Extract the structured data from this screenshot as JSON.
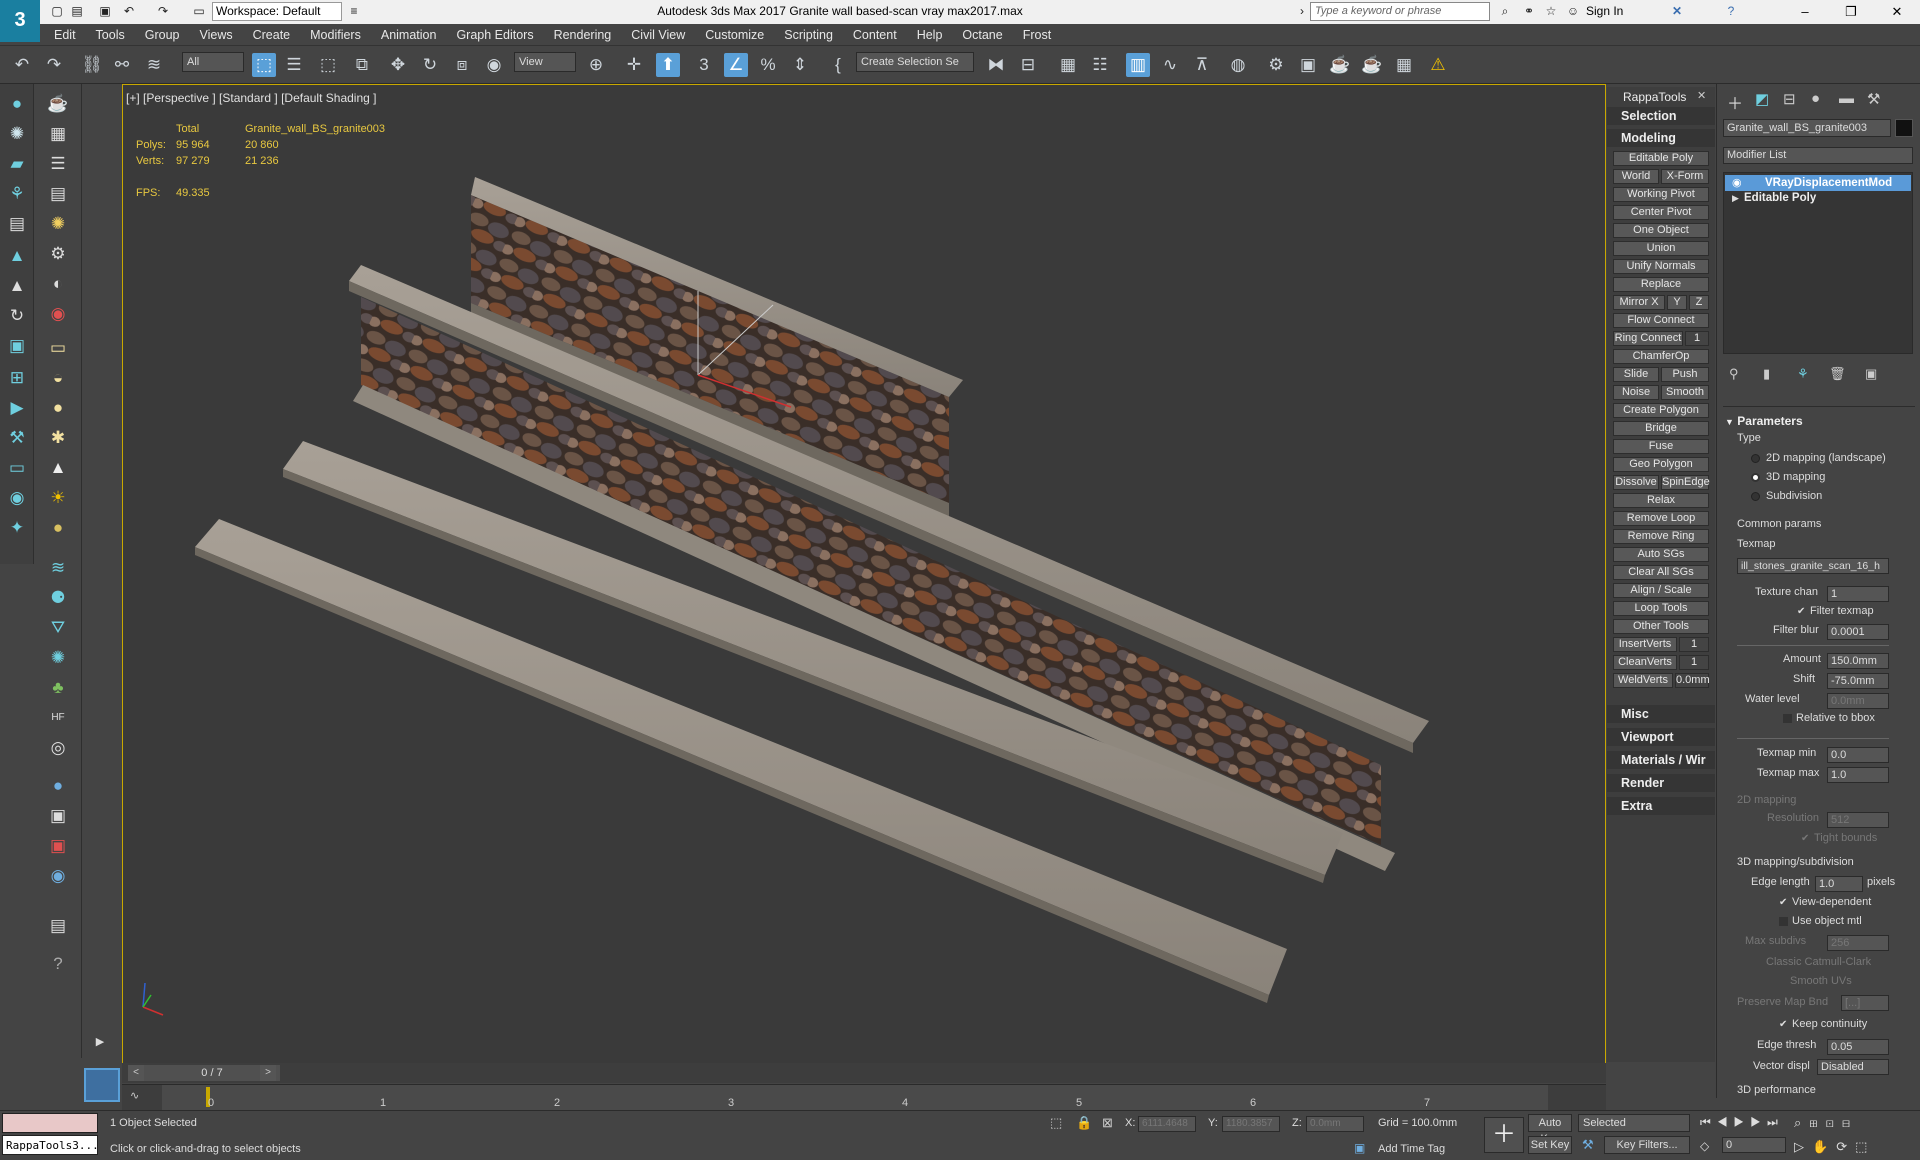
{
  "app": {
    "logo": "3",
    "workspace": "Workspace: Default",
    "title": "Autodesk 3ds Max 2017    Granite wall based-scan vray max2017.max",
    "search_placeholder": "Type a keyword or phrase",
    "sign_in": "Sign In"
  },
  "menu": [
    "Edit",
    "Tools",
    "Group",
    "Views",
    "Create",
    "Modifiers",
    "Animation",
    "Graph Editors",
    "Rendering",
    "Civil View",
    "Customize",
    "Scripting",
    "Content",
    "Help",
    "Octane",
    "Frost"
  ],
  "toolbar": {
    "filter": "All",
    "ref_coord": "View",
    "selection_set": "Create Selection Se"
  },
  "viewport": {
    "label": "[+] [Perspective ] [Standard ] [Default Shading ]",
    "stats": {
      "total_header": "Total",
      "object_header": "Granite_wall_BS_granite003",
      "polys_label": "Polys:",
      "polys_total": "95 964",
      "polys_object": "20 860",
      "verts_label": "Verts:",
      "verts_total": "97 279",
      "verts_object": "21 236",
      "fps_label": "FPS:",
      "fps": "49.335"
    }
  },
  "rappa": {
    "title": "RappaTools",
    "sections": {
      "selection": "Selection",
      "modeling": "Modeling",
      "misc": "Misc",
      "viewport": "Viewport",
      "materials": "Materials / Wir",
      "render": "Render",
      "extra": "Extra"
    },
    "buttons": {
      "editable_poly": "Editable Poly",
      "world": "World",
      "xform": "X-Form",
      "working_pivot": "Working Pivot",
      "center_pivot": "Center Pivot",
      "one_object": "One Object",
      "union": "Union",
      "unify_normals": "Unify Normals",
      "replace": "Replace",
      "mirror_x": "Mirror X",
      "y": "Y",
      "z": "Z",
      "flow_connect": "Flow Connect",
      "ring_connect": "Ring Connect",
      "ring_val": "1",
      "chamferop": "ChamferOp",
      "slide": "Slide",
      "push": "Push",
      "noise": "Noise",
      "smooth": "Smooth",
      "create_polygon": "Create Polygon",
      "bridge": "Bridge",
      "fuse": "Fuse",
      "geo_polygon": "Geo Polygon",
      "dissolve": "Dissolve",
      "spinedge": "SpinEdge",
      "relax": "Relax",
      "remove_loop": "Remove Loop",
      "remove_ring": "Remove Ring",
      "auto_sgs": "Auto SGs",
      "clear_all_sgs": "Clear All SGs",
      "align_scale": "Align / Scale",
      "loop_tools": "Loop Tools",
      "other_tools": "Other Tools",
      "insertverts": "InsertVerts",
      "insertverts_val": "1",
      "cleanverts": "CleanVerts",
      "cleanverts_val": "1",
      "weldverts": "WeldVerts",
      "weldverts_val": "0.0mm"
    }
  },
  "command_panel": {
    "object_name": "Granite_wall_BS_granite003",
    "modifier_list": "Modifier List",
    "stack": [
      "VRayDisplacementMod",
      "Editable Poly"
    ],
    "parameters": "Parameters",
    "type_label": "Type",
    "type_options": [
      "2D mapping (landscape)",
      "3D mapping",
      "Subdivision"
    ],
    "common_params": "Common params",
    "texmap_label": "Texmap",
    "texmap_value": "ill_stones_granite_scan_16_h",
    "texture_chan_label": "Texture chan",
    "texture_chan": "1",
    "filter_texmap": "Filter texmap",
    "filter_blur_label": "Filter blur",
    "filter_blur": "0.0001",
    "amount_label": "Amount",
    "amount": "150.0mm",
    "shift_label": "Shift",
    "shift": "-75.0mm",
    "water_level_label": "Water level",
    "water_level": "0.0mm",
    "relative_bbox": "Relative to bbox",
    "texmap_min_label": "Texmap min",
    "texmap_min": "0.0",
    "texmap_max_label": "Texmap max",
    "texmap_max": "1.0",
    "mapping2d": "2D mapping",
    "resolution_label": "Resolution",
    "resolution": "512",
    "tight_bounds": "Tight bounds",
    "mapping3d": "3D mapping/subdivision",
    "edge_length_label": "Edge length",
    "edge_length": "1.0",
    "pixels": "pixels",
    "view_dependent": "View-dependent",
    "use_object_mtl": "Use object mtl",
    "max_subdivs_label": "Max subdivs",
    "max_subdivs": "256",
    "classic_cc": "Classic Catmull-Clark",
    "smooth_uvs": "Smooth UVs",
    "preserve_map_label": "Preserve Map Bnd",
    "preserve_map": "[...]",
    "keep_continuity": "Keep continuity",
    "edge_thresh_label": "Edge thresh",
    "edge_thresh": "0.05",
    "vector_displ_label": "Vector displ",
    "vector_displ": "Disabled",
    "performance": "3D performance"
  },
  "timeline": {
    "frame_counter": "0 / 7",
    "ticks": [
      "0",
      "1",
      "2",
      "3",
      "4",
      "5",
      "6",
      "7"
    ]
  },
  "status": {
    "maxscript": "RappaTools3...",
    "selected": "1 Object Selected",
    "prompt": "Click or click-and-drag to select objects",
    "x_label": "X:",
    "x": "6111.4648",
    "y_label": "Y:",
    "y": "1180.3857",
    "z_label": "Z:",
    "z": "0.0mm",
    "grid": "Grid = 100.0mm",
    "add_time_tag": "Add Time Tag",
    "auto_key": "Auto Key",
    "set_key": "Set Key",
    "selected_dd": "Selected",
    "key_filters": "Key Filters...",
    "frame": "0"
  }
}
